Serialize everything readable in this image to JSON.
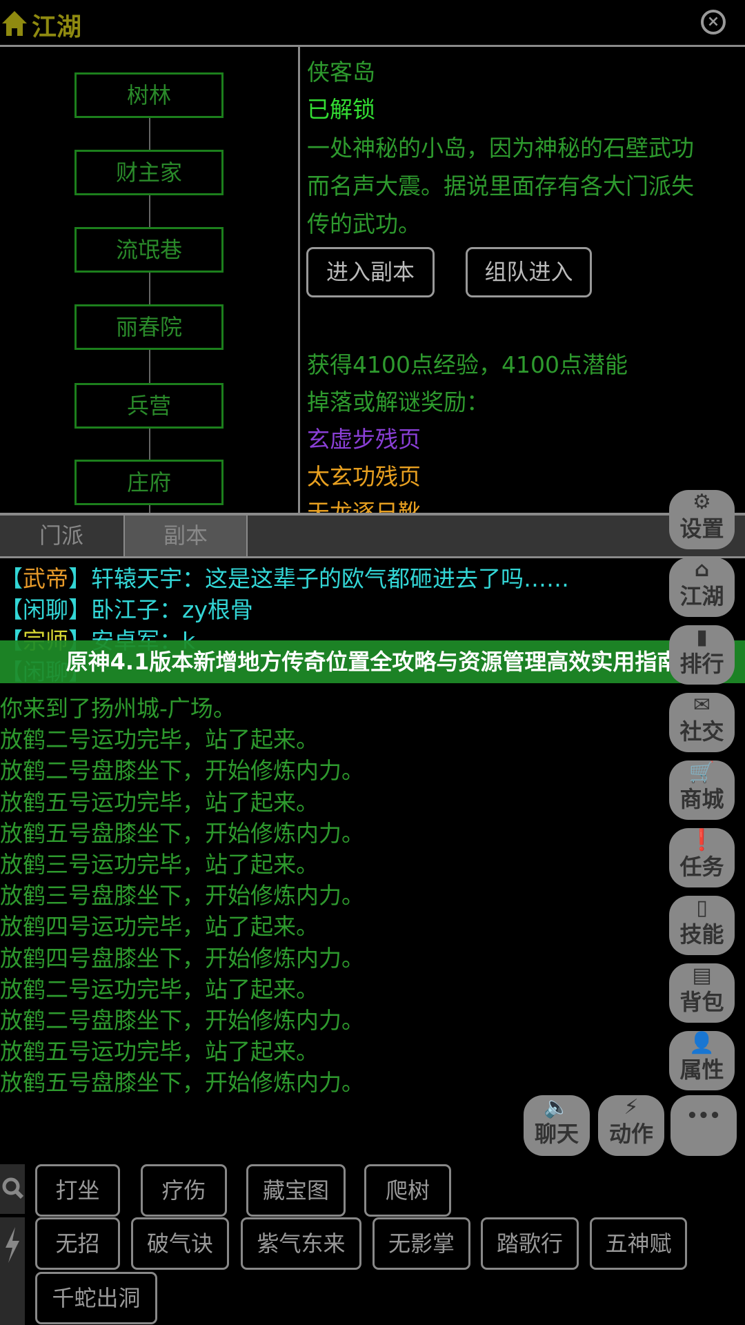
{
  "header": {
    "title": "江湖",
    "home_icon": "home-icon",
    "close_icon": "close-icon"
  },
  "map": {
    "nodes": [
      "树林",
      "财主家",
      "流氓巷",
      "丽春院",
      "兵营",
      "庄府"
    ]
  },
  "detail": {
    "name": "侠客岛",
    "status": "已解锁",
    "description": [
      "一处神秘的小岛，因为神秘的石壁武功",
      "而名声大震。据说里面存有各大门派失",
      "传的武功。"
    ],
    "buttons": [
      "进入副本",
      "组队进入"
    ],
    "reward": "获得4100点经验，4100点潜能",
    "drops_label": "掉落或解谜奖励：",
    "drops": [
      {
        "name": "玄虚步残页",
        "color": "#8a3fd6"
      },
      {
        "name": "太玄功残页",
        "color": "#e8a020"
      },
      {
        "name": "天龙逐日靴",
        "color": "#e8a020"
      }
    ]
  },
  "tabs": [
    {
      "label": "门派"
    },
    {
      "label": "副本",
      "active": true
    }
  ],
  "chat": [
    {
      "tag": "武帝",
      "tag_color": "#e69a2a",
      "text": "轩辕天宇：这是这辈子的欧气都砸进去了吗……"
    },
    {
      "tag": "闲聊",
      "tag_color": "#33d6d6",
      "text": "卧江子：zy根骨"
    },
    {
      "tag": "宗师",
      "tag_color": "#d6d633",
      "text": "安卓军：k"
    },
    {
      "tag": "闲聊",
      "tag_color": "#33d6d6",
      "text": ""
    }
  ],
  "system": [
    "你来到了扬州城-广场。",
    "放鹤二号运功完毕，站了起来。",
    "放鹤二号盘膝坐下，开始修炼内力。",
    "放鹤五号运功完毕，站了起来。",
    "放鹤五号盘膝坐下，开始修炼内力。",
    "放鹤三号运功完毕，站了起来。",
    "放鹤三号盘膝坐下，开始修炼内力。",
    "放鹤四号运功完毕，站了起来。",
    "放鹤四号盘膝坐下，开始修炼内力。",
    "放鹤二号运功完毕，站了起来。",
    "放鹤二号盘膝坐下，开始修炼内力。",
    "放鹤五号运功完毕，站了起来。",
    "放鹤五号盘膝坐下，开始修炼内力。"
  ],
  "banner": "原神4.1版本新增地方传奇位置全攻略与资源管理高效实用指南",
  "side_menu": [
    {
      "label": "设置",
      "icon": "gear-icon",
      "glyph": "⚙"
    },
    {
      "label": "江湖",
      "icon": "home-icon",
      "glyph": "⌂"
    },
    {
      "label": "排行",
      "icon": "bar-chart-icon",
      "glyph": "▮"
    },
    {
      "label": "社交",
      "icon": "mail-icon",
      "glyph": "✉"
    },
    {
      "label": "商城",
      "icon": "cart-icon",
      "glyph": "🛒"
    },
    {
      "label": "任务",
      "icon": "alert-icon",
      "glyph": "❗"
    },
    {
      "label": "技能",
      "icon": "book-icon",
      "glyph": "▯"
    },
    {
      "label": "背包",
      "icon": "briefcase-icon",
      "glyph": "▤"
    },
    {
      "label": "属性",
      "icon": "person-icon",
      "glyph": "👤"
    }
  ],
  "bottom_menu": [
    {
      "label": "聊天",
      "icon": "speaker-icon",
      "glyph": "🔈"
    },
    {
      "label": "动作",
      "icon": "lightning-icon",
      "glyph": "⚡"
    },
    {
      "label": "",
      "icon": "more-icon",
      "glyph": "•••"
    }
  ],
  "skills": {
    "search_icon": "search-icon",
    "lightning_icon": "lightning-icon",
    "row1": [
      "打坐",
      "疗伤",
      "藏宝图",
      "爬树"
    ],
    "row2": [
      "无招",
      "破气诀",
      "紫气东来",
      "无影掌",
      "踏歌行",
      "五神赋"
    ],
    "row3": [
      "千蛇出洞"
    ]
  }
}
